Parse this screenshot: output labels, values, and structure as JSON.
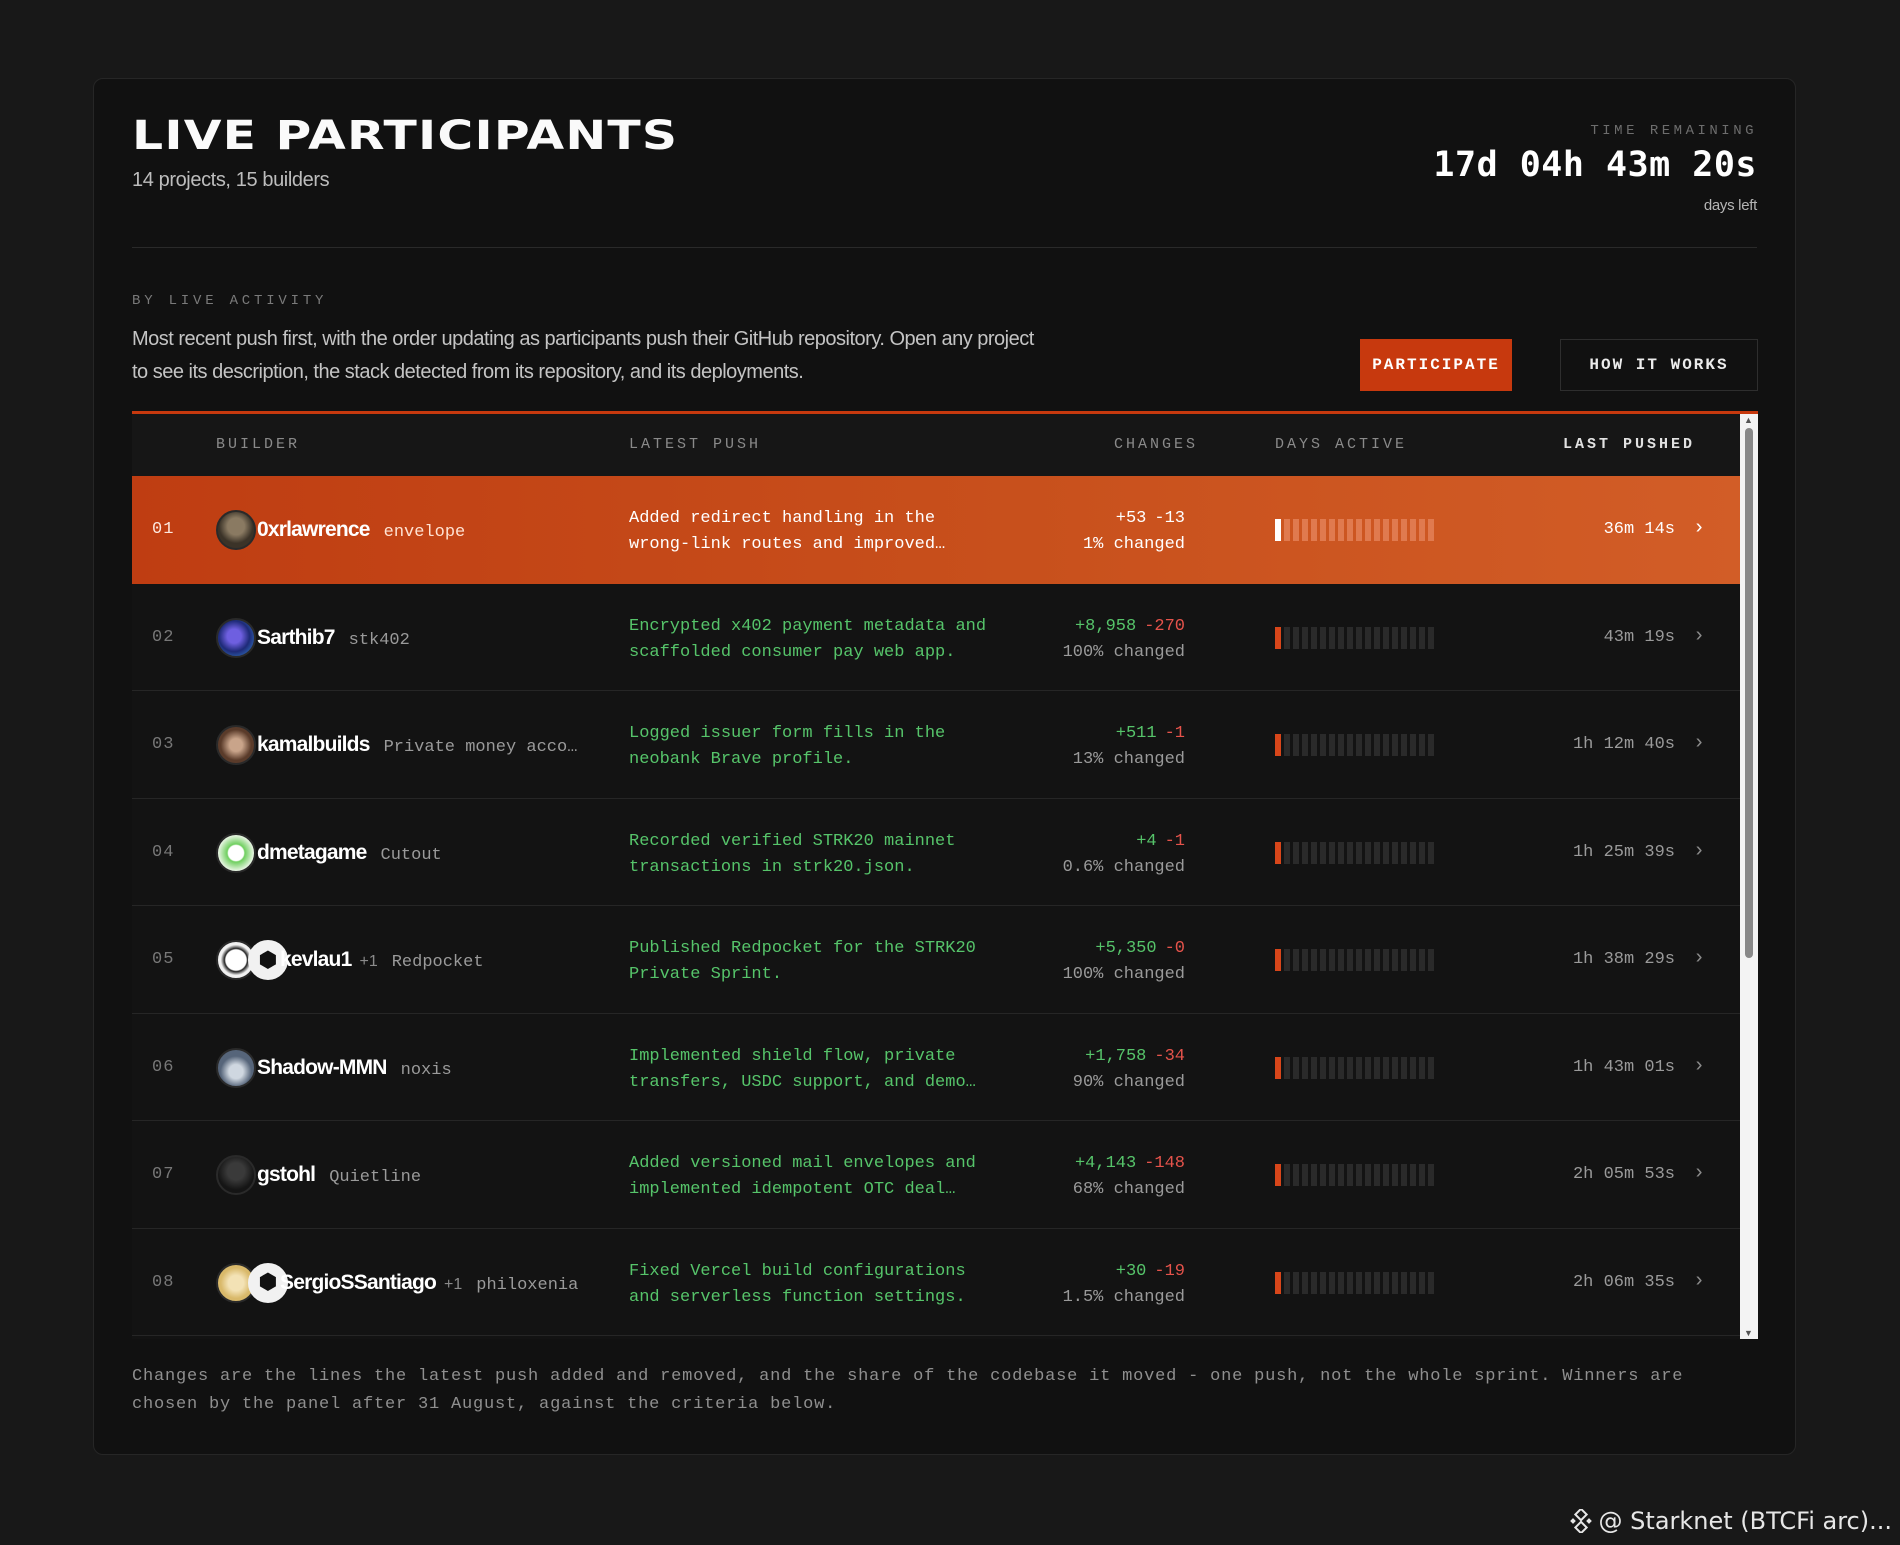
{
  "header": {
    "title": "LIVE PARTICIPANTS",
    "subtitle": "14 projects, 15 builders",
    "timer_label": "TIME REMAINING",
    "timer_value": "17d 04h 43m 20s",
    "timer_sub": "days left"
  },
  "section": {
    "label": "BY LIVE ACTIVITY",
    "description": "Most recent push first, with the order updating as participants push their GitHub repository. Open any project to see its description, the stack detected from its repository, and its deployments."
  },
  "buttons": {
    "participate": "PARTICIPATE",
    "how_it_works": "HOW IT WORKS"
  },
  "table": {
    "columns": {
      "builder": "BUILDER",
      "latest_push": "LATEST PUSH",
      "changes": "CHANGES",
      "days_active": "DAYS ACTIVE",
      "last_pushed": "LAST PUSHED"
    },
    "rows": [
      {
        "rank": "01",
        "builder": "0xrlawrence",
        "extra": "",
        "project": "envelope",
        "push": "Added redirect handling in the wrong-link routes and improved…",
        "added": "+53",
        "removed": "-13",
        "changed": "1% changed",
        "last_pushed": "36m 14s",
        "days_active": 1
      },
      {
        "rank": "02",
        "builder": "Sarthib7",
        "extra": "",
        "project": "stk402",
        "push": "Encrypted x402 payment metadata and scaffolded consumer pay web app.",
        "added": "+8,958",
        "removed": "-270",
        "changed": "100% changed",
        "last_pushed": "43m 19s",
        "days_active": 1
      },
      {
        "rank": "03",
        "builder": "kamalbuilds",
        "extra": "",
        "project": "Private money acco…",
        "push": "Logged issuer form fills in the neobank Brave profile.",
        "added": "+511",
        "removed": "-1",
        "changed": "13% changed",
        "last_pushed": "1h 12m 40s",
        "days_active": 1
      },
      {
        "rank": "04",
        "builder": "dmetagame",
        "extra": "",
        "project": "Cutout",
        "push": "Recorded verified STRK20 mainnet transactions in strk20.json.",
        "added": "+4",
        "removed": "-1",
        "changed": "0.6% changed",
        "last_pushed": "1h 25m 39s",
        "days_active": 1
      },
      {
        "rank": "05",
        "builder": "kevlau1",
        "extra": "+1",
        "project": "Redpocket",
        "push": "Published Redpocket for the STRK20 Private Sprint.",
        "added": "+5,350",
        "removed": "-0",
        "changed": "100% changed",
        "last_pushed": "1h 38m 29s",
        "days_active": 1
      },
      {
        "rank": "06",
        "builder": "Shadow-MMN",
        "extra": "",
        "project": "noxis",
        "push": "Implemented shield flow, private transfers, USDC support, and demo…",
        "added": "+1,758",
        "removed": "-34",
        "changed": "90% changed",
        "last_pushed": "1h 43m 01s",
        "days_active": 1
      },
      {
        "rank": "07",
        "builder": "gstohl",
        "extra": "",
        "project": "Quietline",
        "push": "Added versioned mail envelopes and implemented idempotent OTC deal…",
        "added": "+4,143",
        "removed": "-148",
        "changed": "68% changed",
        "last_pushed": "2h 05m 53s",
        "days_active": 1
      },
      {
        "rank": "08",
        "builder": "SergioSSantiago",
        "extra": "+1",
        "project": "philoxenia",
        "push": "Fixed Vercel build configurations and serverless function settings.",
        "added": "+30",
        "removed": "-19",
        "changed": "1.5% changed",
        "last_pushed": "2h 06m 35s",
        "days_active": 1
      }
    ],
    "days_total": 18
  },
  "footnote": "Changes are the lines the latest push added and removed, and the share of the codebase it moved - one push, not the whole sprint. Winners are chosen by the panel after 31 August, against the criteria below.",
  "watermark": "@ Starknet (BTCFi arc)...",
  "colors": {
    "accent": "#c7390e",
    "added": "#56c46a",
    "removed": "#e5534b",
    "background": "#181818",
    "panel": "#111111"
  }
}
